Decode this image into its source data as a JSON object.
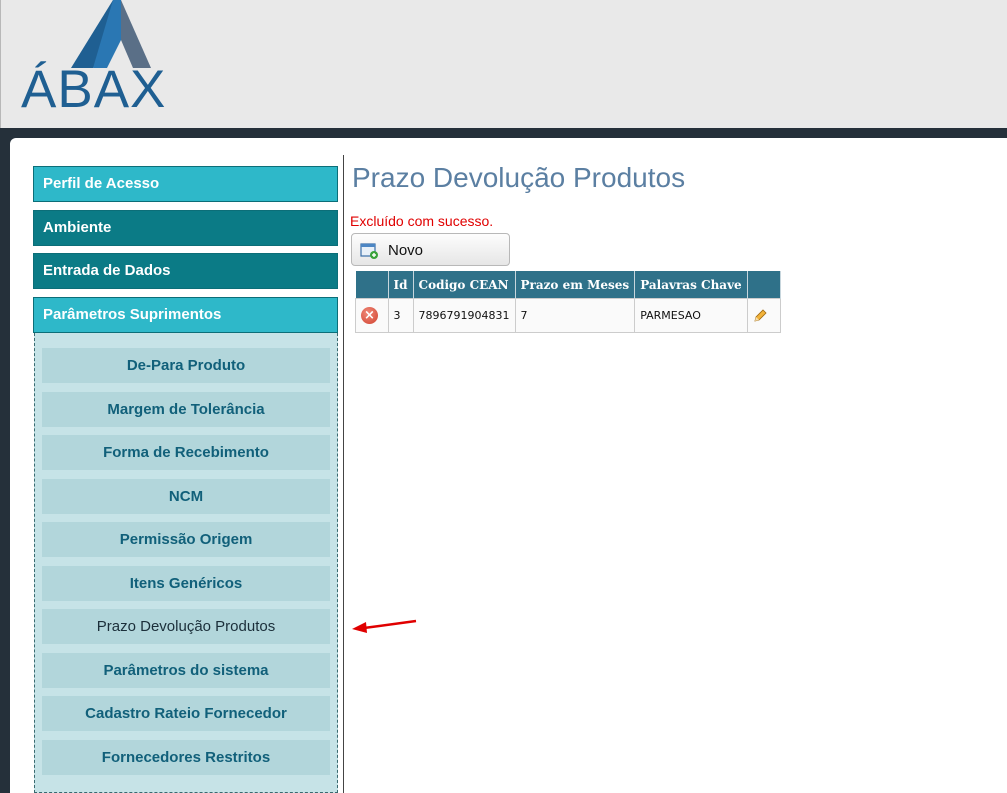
{
  "header": {
    "logo_text": "ÁBAX"
  },
  "sidebar": {
    "sections": [
      {
        "label": "Perfil de Acesso"
      },
      {
        "label": "Ambiente"
      },
      {
        "label": "Entrada de Dados"
      },
      {
        "label": "Parâmetros Suprimentos"
      }
    ],
    "items": [
      {
        "label": "De-Para Produto"
      },
      {
        "label": "Margem de Tolerância"
      },
      {
        "label": "Forma de Recebimento"
      },
      {
        "label": "NCM"
      },
      {
        "label": "Permissão Origem"
      },
      {
        "label": "Itens Genéricos"
      },
      {
        "label": "Prazo Devolução Produtos"
      },
      {
        "label": "Parâmetros do sistema"
      },
      {
        "label": "Cadastro Rateio Fornecedor"
      },
      {
        "label": "Fornecedores Restritos"
      }
    ]
  },
  "main": {
    "title": "Prazo Devolução Produtos",
    "message": "Excluído com sucesso.",
    "new_button": "Novo",
    "table": {
      "headers": [
        "",
        "Id",
        "Codigo CEAN",
        "Prazo em Meses",
        "Palavras Chave",
        ""
      ],
      "rows": [
        {
          "id": "3",
          "cean": "7896791904831",
          "prazo": "7",
          "palavras": "PARMESAO"
        }
      ]
    }
  },
  "colors": {
    "header_bg": "#e9e9e9",
    "menu_light": "#2eb8c9",
    "menu_dark": "#0b7b86",
    "submenu_bg": "#b2d6db",
    "table_header": "#2f7189",
    "title": "#5b7fa2",
    "message": "#e00000",
    "arrow": "#e00000"
  }
}
